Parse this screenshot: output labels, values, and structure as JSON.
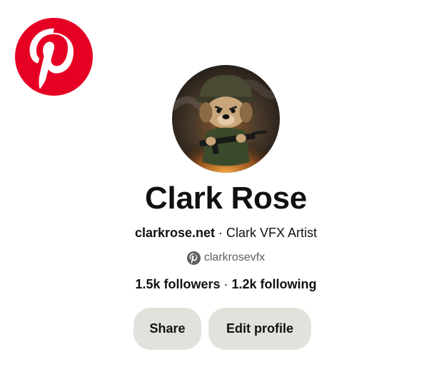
{
  "brand": {
    "logo_icon": "pinterest-logo-icon",
    "color": "#e60023"
  },
  "profile": {
    "avatar_icon": "profile-avatar-image",
    "name": "Clark Rose",
    "website": "clarkrose.net",
    "separator": " · ",
    "bio": "Clark VFX Artist",
    "handle_icon": "pinterest-icon",
    "handle": "clarkrosevfx",
    "followers": "1.5k followers",
    "following": "1.2k following"
  },
  "actions": {
    "share_label": "Share",
    "edit_label": "Edit profile",
    "button_color": "#e2e2dc"
  }
}
